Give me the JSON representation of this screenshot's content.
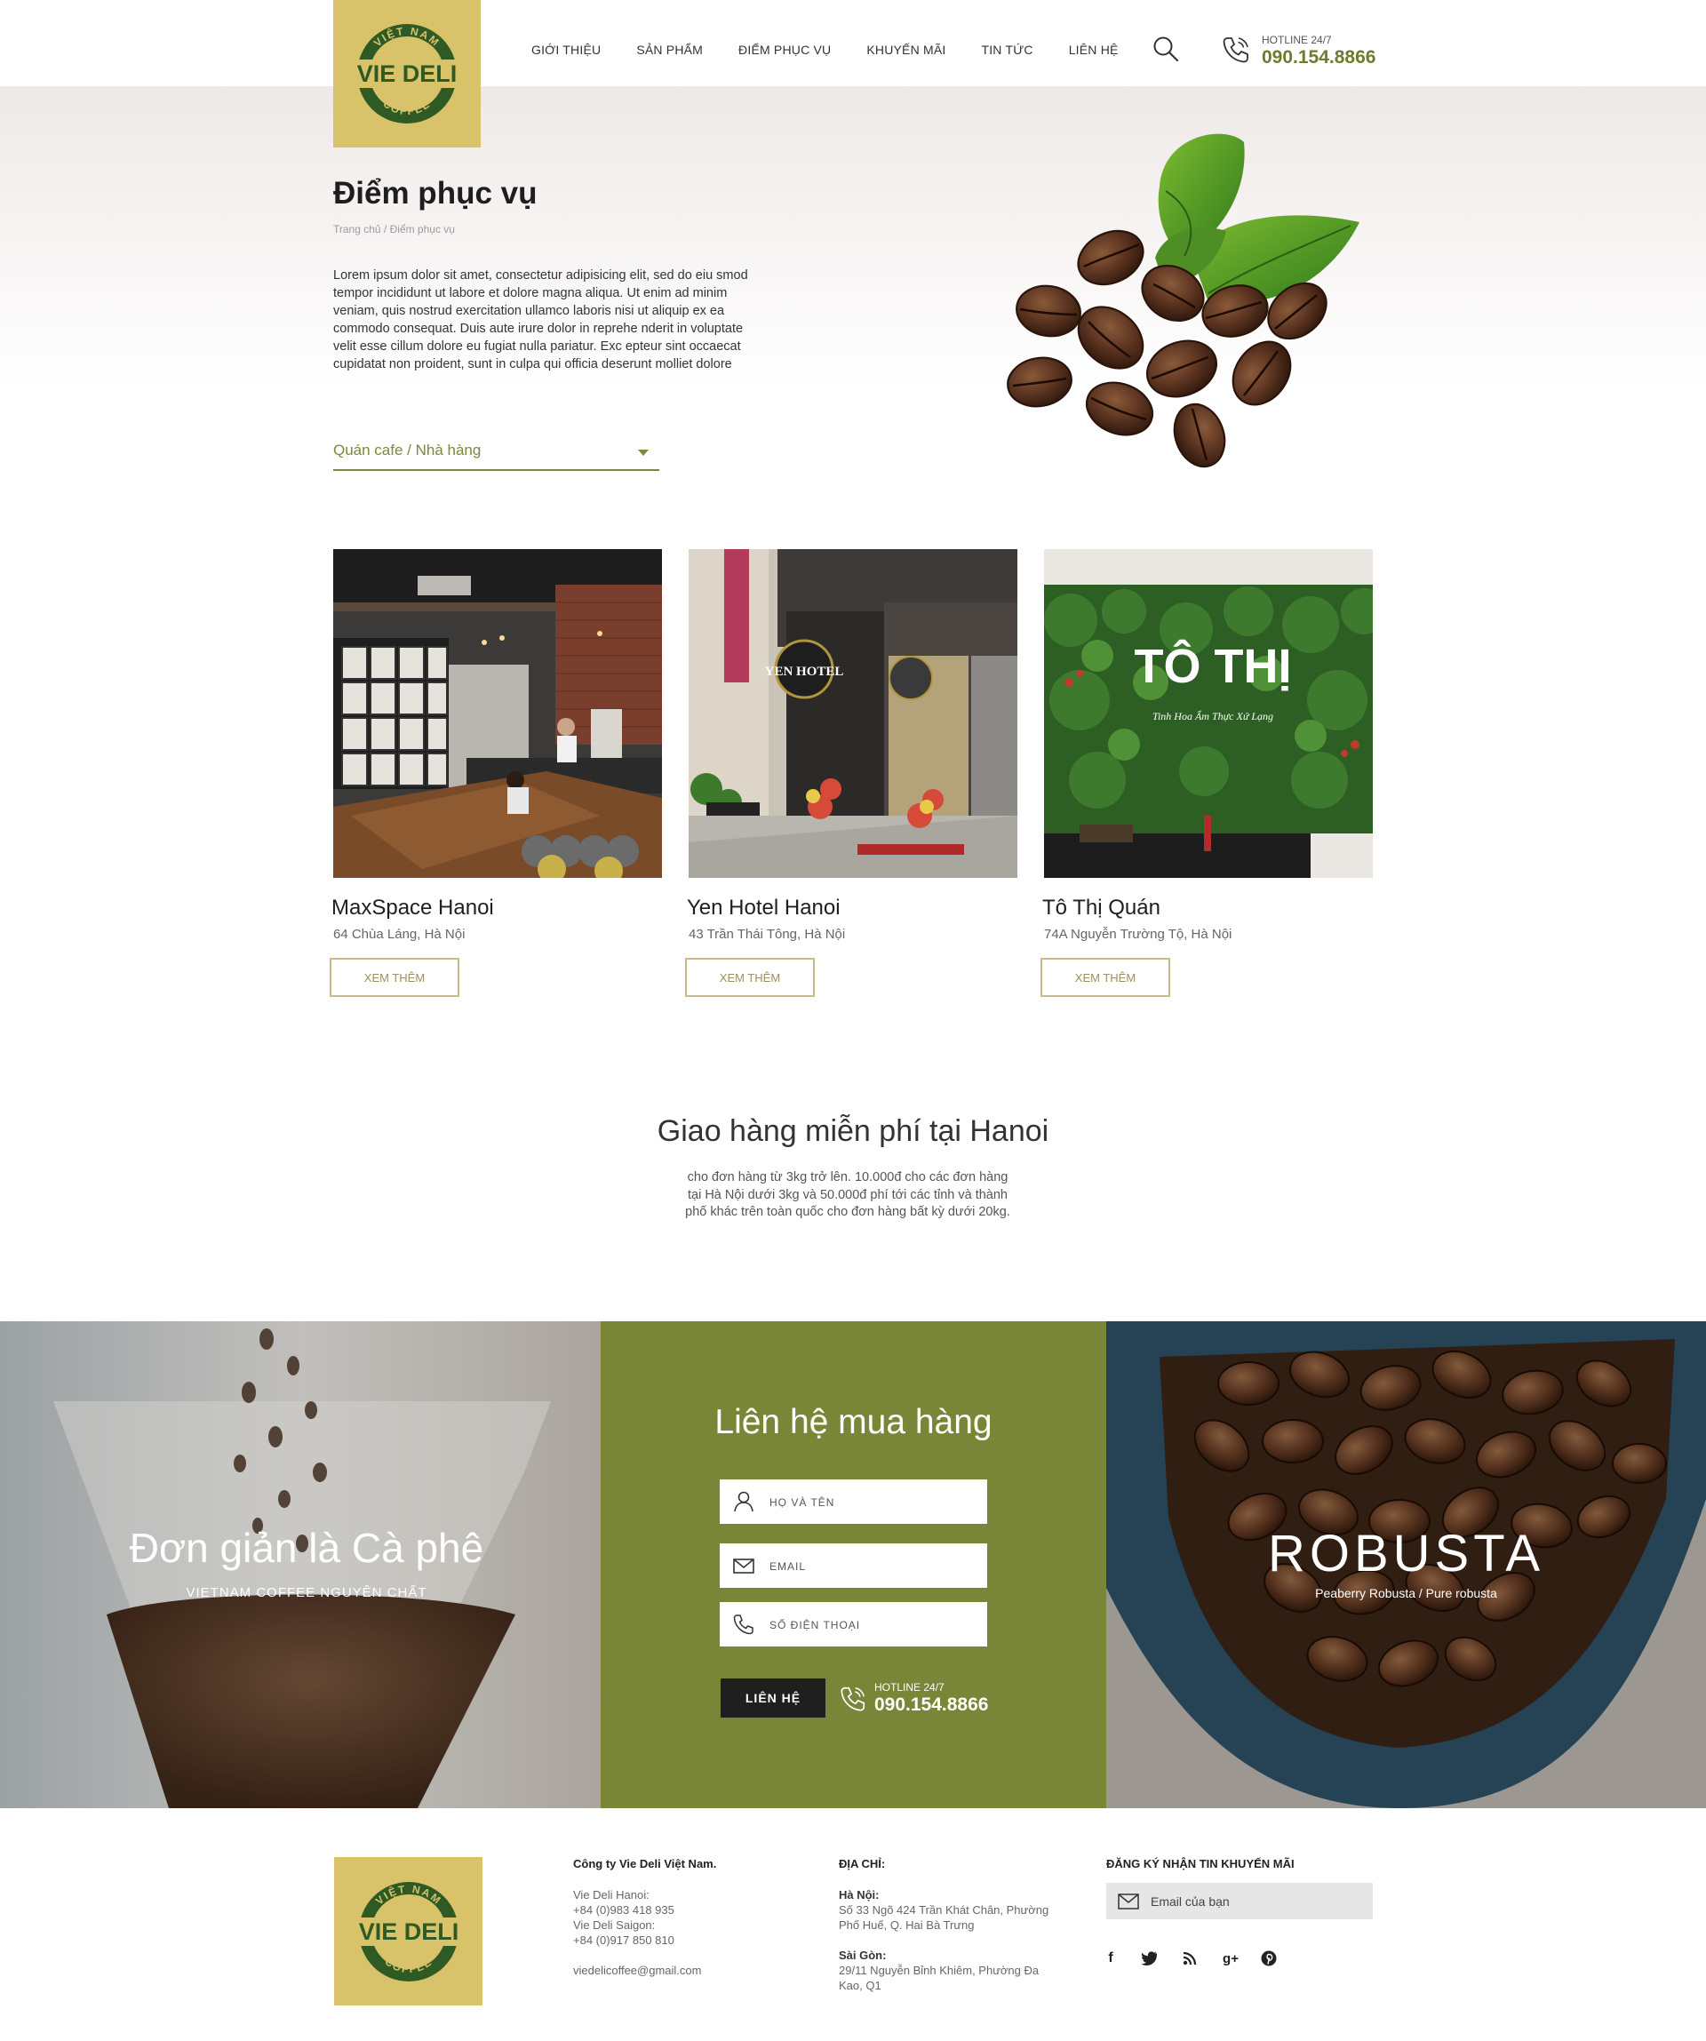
{
  "header": {
    "nav": [
      "GIỚI THIỆU",
      "SẢN PHẨM",
      "ĐIỂM PHỤC VỤ",
      "KHUYẾN MÃI",
      "TIN TỨC",
      "LIÊN HỆ"
    ],
    "hotline_label": "HOTLINE 24/7",
    "hotline_number": "090.154.8866"
  },
  "logo": {
    "top_text": "VIỆT NAM",
    "main_text": "VIE DELI",
    "bottom_text": "COFFEE"
  },
  "hero": {
    "title": "Điểm phục vụ",
    "breadcrumb": "Trang chủ / Điểm phục vụ",
    "intro": "Lorem ipsum dolor sit amet, consectetur adipisicing elit, sed do eiu smod tempor incididunt ut labore et dolore magna aliqua. Ut enim ad minim veniam, quis nostrud exercitation ullamco laboris nisi ut aliquip ex ea commodo consequat. Duis aute irure dolor in reprehe nderit in voluptate velit esse cillum dolore eu fugiat nulla pariatur. Exc epteur sint occaecat cupidatat non proident, sunt in culpa qui officia deserunt molliet dolore",
    "filter_value": "Quán cafe / Nhà hàng"
  },
  "locations": [
    {
      "name": "MaxSpace Hanoi",
      "address": "64 Chùa Láng, Hà Nội",
      "button": "XEM THÊM"
    },
    {
      "name": "Yen Hotel Hanoi",
      "address": "43 Trần Thái Tông, Hà Nội",
      "button": "XEM THÊM",
      "sign_text": "YEN HOTEL"
    },
    {
      "name": "Tô Thị Quán",
      "address": "74A Nguyễn Trường Tộ, Hà Nội",
      "button": "XEM THÊM",
      "sign_text": "TÔ THỊ",
      "sign_sub": "Tinh Hoa Ẩm Thực Xứ Lạng"
    }
  ],
  "delivery": {
    "title": "Giao hàng miễn phí tại Hanoi",
    "text": "cho đơn hàng từ 3kg trở lên. 10.000đ cho các đơn hàng tại Hà Nội dưới 3kg và 50.000đ phí tới các tỉnh và thành phố khác trên toàn quốc cho đơn hàng bất kỳ dưới 20kg."
  },
  "band": {
    "left_title": "Đơn giản là Cà phê",
    "left_sub": "VIETNAM COFFEE NGUYÊN CHẤT",
    "contact_title": "Liên hệ mua hàng",
    "name_placeholder": "HỌ VÀ TÊN",
    "email_placeholder": "EMAIL",
    "phone_placeholder": "SỐ ĐIỆN THOẠI",
    "submit": "LIÊN HỆ",
    "hotline_label": "HOTLINE 24/7",
    "hotline_number": "090.154.8866",
    "right_title": "ROBUSTA",
    "right_sub": "Peaberry Robusta / Pure robusta"
  },
  "footer": {
    "company": "Công ty Vie Deli Việt Nam.",
    "hanoi_label": "Vie Deli Hanoi:",
    "hanoi_phone": "+84 (0)983 418 935",
    "saigon_label": "Vie Deli Saigon:",
    "saigon_phone": "+84 (0)917 850 810",
    "email": "viedelicoffee@gmail.com",
    "address_head": "ĐỊA CHỈ:",
    "hn_head": "Hà Nội:",
    "hn_addr": "Số 33 Ngõ 424 Trần Khát Chân, Phường Phố Huế, Q. Hai Bà Trưng",
    "sg_head": "Sài Gòn:",
    "sg_addr": "29/11 Nguyễn Bỉnh Khiêm, Phường Đa Kao, Q1",
    "newsletter_head": "ĐĂNG KÝ NHẬN TIN KHUYẾN MÃI",
    "newsletter_placeholder": "Email của bạn",
    "social": [
      "f",
      "t",
      "rss",
      "g+",
      "p"
    ]
  },
  "colors": {
    "olive": "#7a8637",
    "logo_gold": "#d8c26a",
    "logo_green": "#2f5a23",
    "button_border": "#c7b889"
  }
}
